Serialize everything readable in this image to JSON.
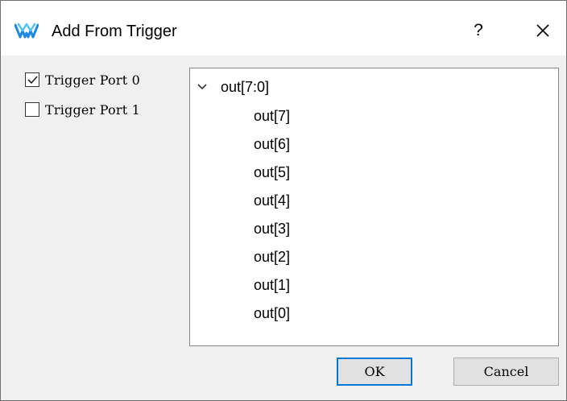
{
  "window": {
    "title": "Add From Trigger",
    "help_label": "?",
    "close_icon": "close-icon",
    "app_icon": "gowin-logo-icon",
    "accent": "#0078d7"
  },
  "trigger_ports": [
    {
      "label": "Trigger Port 0",
      "checked": true
    },
    {
      "label": "Trigger Port 1",
      "checked": false
    }
  ],
  "tree": {
    "root": {
      "label": "out[7:0]",
      "expanded": true,
      "icon": "chevron-down-icon"
    },
    "children": [
      "out[7]",
      "out[6]",
      "out[5]",
      "out[4]",
      "out[3]",
      "out[2]",
      "out[1]",
      "out[0]"
    ]
  },
  "buttons": {
    "ok_label": "OK",
    "cancel_label": "Cancel"
  }
}
